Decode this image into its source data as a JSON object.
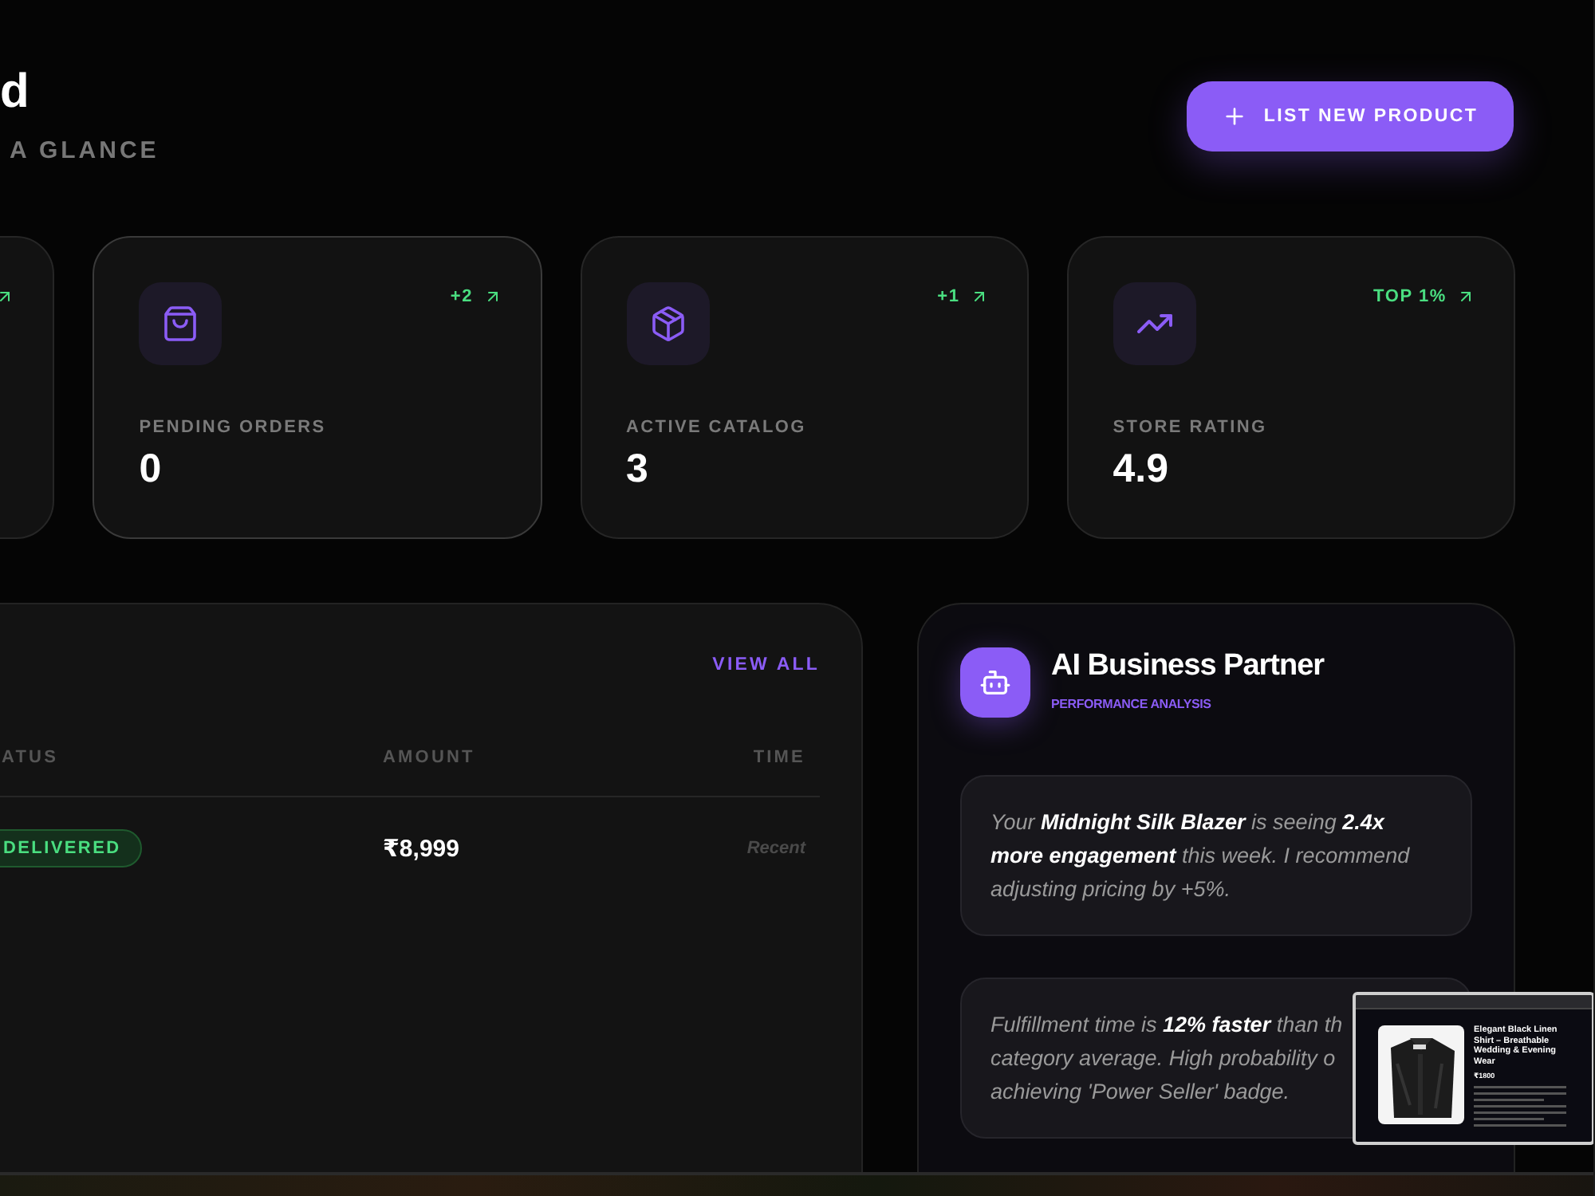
{
  "header": {
    "title": "d",
    "subtitle": "A GLANCE",
    "action": {
      "label": "LIST NEW PRODUCT"
    }
  },
  "stats": [
    {
      "kind": "partial",
      "hovered": false
    },
    {
      "kind": "orders",
      "hovered": true,
      "trend": "+2",
      "label": "PENDING ORDERS",
      "value": "0"
    },
    {
      "kind": "catalog",
      "hovered": false,
      "trend": "+1",
      "label": "ACTIVE CATALOG",
      "value": "3"
    },
    {
      "kind": "rating",
      "hovered": false,
      "trend": "TOP 1%",
      "label": "STORE RATING",
      "value": "4.9"
    }
  ],
  "orders": {
    "link": "VIEW ALL",
    "columns": [
      "ATUS",
      "AMOUNT",
      "TIME"
    ],
    "rows": [
      {
        "status": "DELIVERED",
        "amount": "₹8,999",
        "time": "Recent"
      }
    ]
  },
  "assistant": {
    "title": "AI Business Partner",
    "subtitle": "PERFORMANCE ANALYSIS",
    "insights": [
      {
        "lines": [
          "Your **Midnight Silk Blazer** is seeing **2.4x**",
          "**more engagement** this week. I recommend",
          "adjusting pricing by +5%."
        ]
      },
      {
        "lines": [
          "Fulfillment time is **12% faster** than th",
          "category average. High probability o",
          "achieving 'Power Seller' badge."
        ]
      }
    ]
  },
  "thumbnail": {
    "title": "Elegant Black Linen Shirt – Breathable Wedding & Evening Wear",
    "price": "₹1800"
  }
}
